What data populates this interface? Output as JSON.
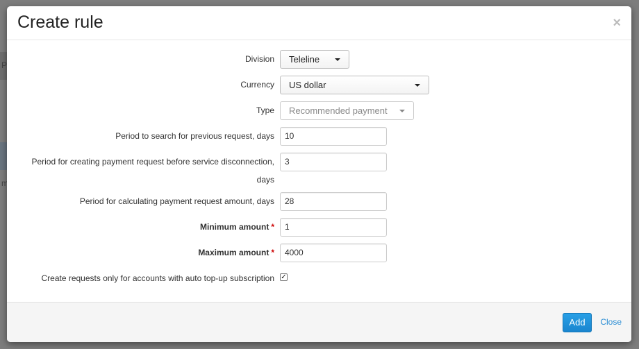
{
  "dialog": {
    "title": "Create rule",
    "close_icon": "×"
  },
  "background": {
    "char1": "P",
    "char2": "m"
  },
  "fields": {
    "division": {
      "label": "Division",
      "value": "Teleline"
    },
    "currency": {
      "label": "Currency",
      "value": "US dollar"
    },
    "type": {
      "label": "Type",
      "value": "Recommended payment"
    },
    "search_period": {
      "label": "Period to search for previous request, days",
      "value": "10"
    },
    "creating_period": {
      "label": "Period for creating payment request before service disconnection,",
      "label_line2": "days",
      "value": "3"
    },
    "calc_period": {
      "label": "Period for calculating payment request amount, days",
      "value": "28"
    },
    "min_amount": {
      "label": "Minimum amount",
      "required_mark": "*",
      "value": "1"
    },
    "max_amount": {
      "label": "Maximum amount",
      "required_mark": "*",
      "value": "4000"
    },
    "auto_topup": {
      "label": "Create requests only for accounts with auto top-up subscription",
      "checked": true,
      "check_mark": "✓"
    }
  },
  "footer": {
    "add_label": "Add",
    "close_label": "Close"
  },
  "colors": {
    "primary": "#1a86cf",
    "link": "#2a8dd4",
    "required": "#cc0000"
  }
}
